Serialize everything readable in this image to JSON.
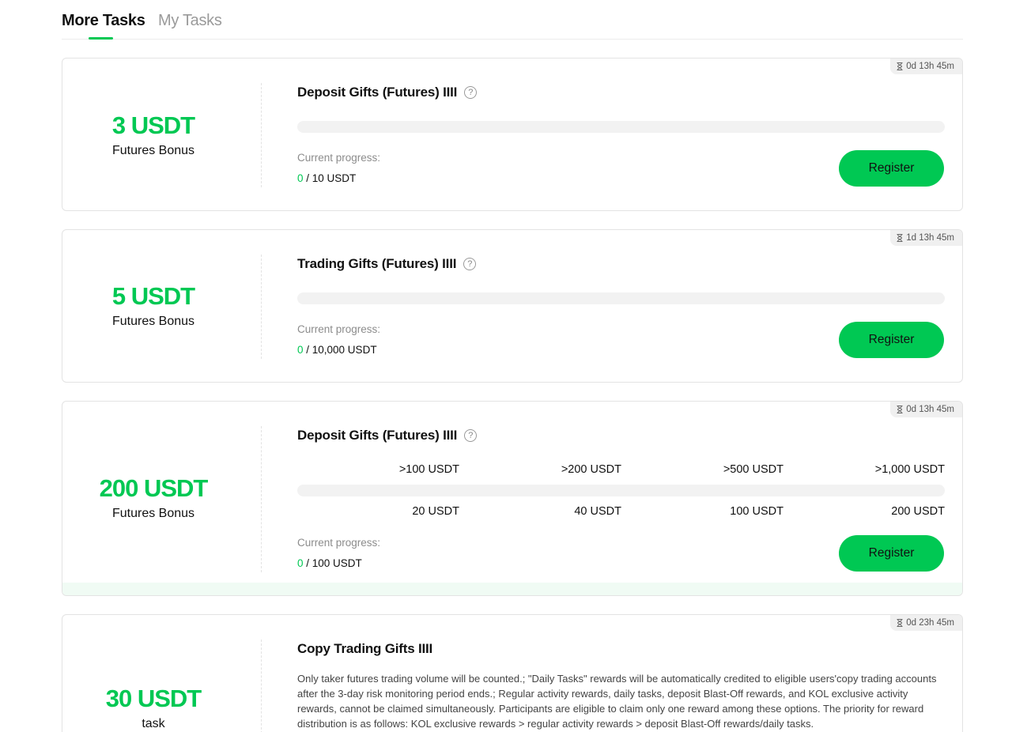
{
  "tabs": [
    {
      "label": "More Tasks",
      "active": true
    },
    {
      "label": "My Tasks",
      "active": false
    }
  ],
  "accent_color": "#00c853",
  "cards": [
    {
      "timer": "0d 13h 45m",
      "reward_amount": "3 USDT",
      "reward_label": "Futures Bonus",
      "title": "Deposit Gifts (Futures) IIII",
      "progress_label": "Current progress:",
      "progress_current": "0",
      "progress_target": " / 10 USDT",
      "progress_fraction": 0,
      "button_label": "Register"
    },
    {
      "timer": "1d 13h 45m",
      "reward_amount": "5 USDT",
      "reward_label": "Futures Bonus",
      "title": "Trading Gifts (Futures) IIII",
      "progress_label": "Current progress:",
      "progress_current": "0",
      "progress_target": " / 10,000 USDT",
      "progress_fraction": 0,
      "button_label": "Register"
    },
    {
      "timer": "0d 13h 45m",
      "reward_amount": "200 USDT",
      "reward_label": "Futures Bonus",
      "title": "Deposit Gifts (Futures) IIII",
      "tiers": [
        {
          "threshold": ">100 USDT",
          "reward": "20 USDT"
        },
        {
          "threshold": ">200 USDT",
          "reward": "40 USDT"
        },
        {
          "threshold": ">500 USDT",
          "reward": "100 USDT"
        },
        {
          "threshold": ">1,000 USDT",
          "reward": "200 USDT"
        }
      ],
      "progress_label": "Current progress:",
      "progress_current": "0",
      "progress_target": " / 100 USDT",
      "progress_fraction": 0,
      "button_label": "Register"
    },
    {
      "timer": "0d 23h 45m",
      "reward_amount": "30 USDT",
      "reward_label": "task",
      "title": "Copy Trading Gifts IIII",
      "description": "Only taker futures trading volume will be counted.; \"Daily Tasks\" rewards will be automatically credited to eligible users'copy trading accounts after the 3-day risk monitoring period ends.; Regular activity rewards, daily tasks, deposit Blast-Off rewards, and KOL exclusive activity rewards, cannot be claimed simultaneously. Participants are eligible to claim only one reward among these options. The priority for reward distribution is as follows: KOL exclusive rewards > regular activity rewards > deposit Blast-Off rewards/daily tasks."
    }
  ]
}
